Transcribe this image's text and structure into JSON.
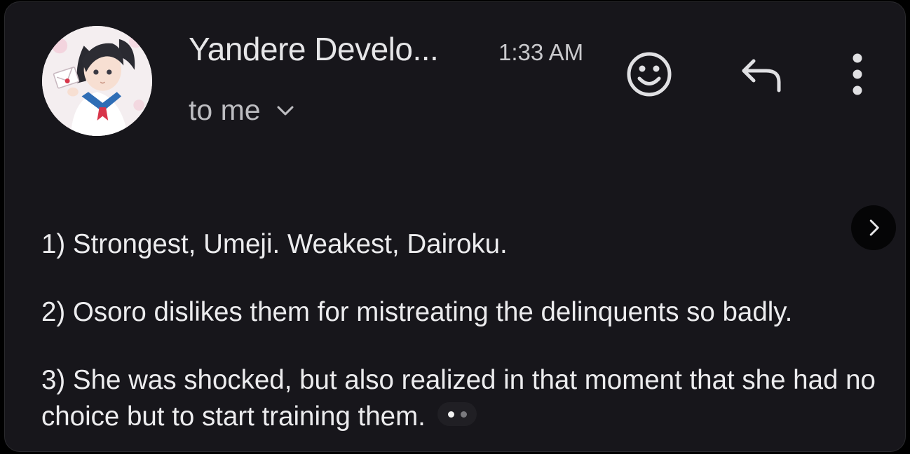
{
  "header": {
    "sender": "Yandere Develo...",
    "time": "1:33 AM",
    "recipient": "to me"
  },
  "icons": {
    "avatar": "avatar-anime-girl",
    "recipient_toggle": "chevron-down-icon",
    "emoji": "smiley-icon",
    "reply": "reply-icon",
    "more": "more-vert-icon",
    "next": "chevron-right-icon"
  },
  "message": {
    "paragraph_1": "1) Strongest, Umeji. Weakest, Dairoku.",
    "paragraph_2": "2) Osoro dislikes them for mistreating the delinquents so badly.",
    "paragraph_3": "3) She was shocked, but also realized in that moment that she had no choice but to start training them."
  },
  "pager": {
    "total": 2,
    "current": 1
  },
  "colors": {
    "background": "#17161b",
    "text_primary": "#e6e6e8",
    "text_secondary": "#bdbdc1",
    "icon": "#e0e0e3"
  }
}
